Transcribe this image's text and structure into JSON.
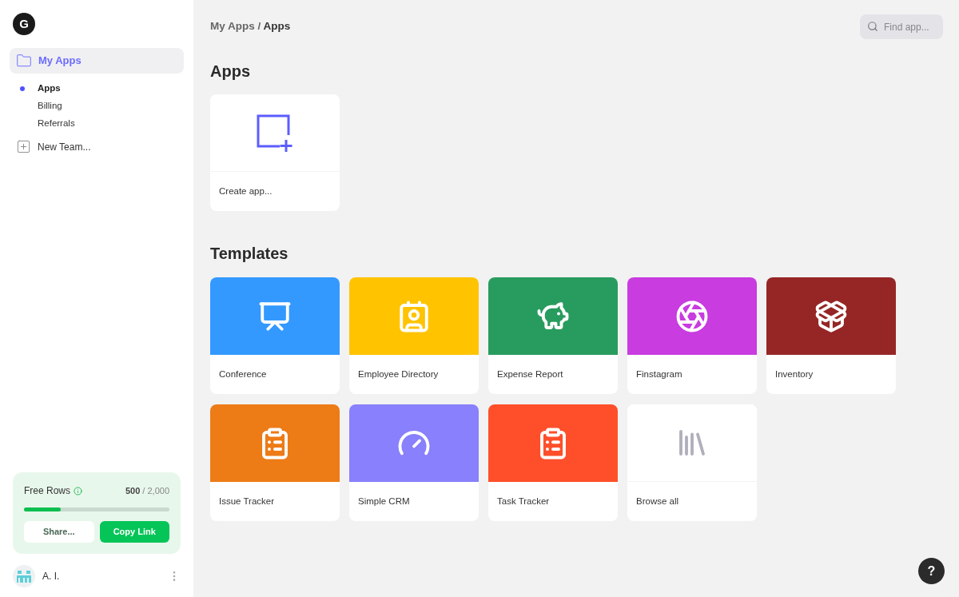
{
  "logo": {
    "letter": "G"
  },
  "sidebar": {
    "team": {
      "label": "My Apps",
      "selected": true
    },
    "items": [
      {
        "label": "Apps",
        "selected": true
      },
      {
        "label": "Billing",
        "selected": false
      },
      {
        "label": "Referrals",
        "selected": false
      }
    ],
    "new_team": "New Team...",
    "usage": {
      "title": "Free Rows",
      "used": "500",
      "total": "/ 2,000",
      "level": 0.25,
      "share": "Share...",
      "copy": "Copy Link"
    },
    "user": {
      "name": "A. I."
    }
  },
  "breadcrumb": {
    "parent": "My Apps",
    "separator": "/",
    "current": "Apps"
  },
  "search": {
    "placeholder": "Find app..."
  },
  "apps": {
    "title": "Apps",
    "create": "Create app..."
  },
  "templates": {
    "title": "Templates",
    "items": [
      {
        "name": "Conference",
        "kind": "conference",
        "color": "#3399ff"
      },
      {
        "name": "Employee Directory",
        "kind": "contact",
        "color": "#ffc300"
      },
      {
        "name": "Expense Report",
        "kind": "piggy",
        "color": "#289c5e"
      },
      {
        "name": "Finstagram",
        "kind": "aperture",
        "color": "#c83ce0"
      },
      {
        "name": "Inventory",
        "kind": "inventory",
        "color": "#962626"
      },
      {
        "name": "Issue Tracker",
        "kind": "clipboard",
        "color": "#ed7b16"
      },
      {
        "name": "Simple CRM",
        "kind": "gauge",
        "color": "#8880fc"
      },
      {
        "name": "Task Tracker",
        "kind": "clipboard",
        "color": "#ff4f2a"
      },
      {
        "name": "Browse all",
        "kind": "browse",
        "color": "#ffffff"
      }
    ]
  },
  "help": "?"
}
